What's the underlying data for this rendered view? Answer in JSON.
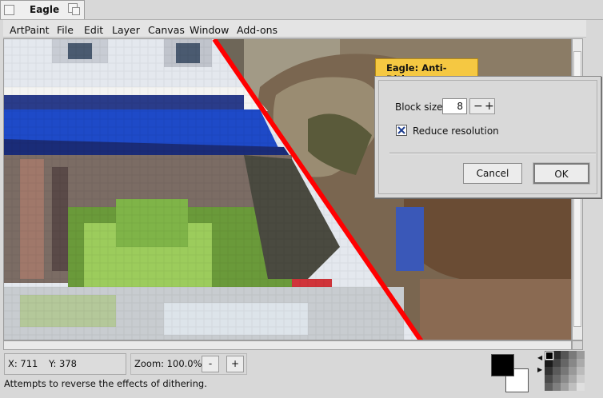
{
  "window": {
    "title": "Eagle"
  },
  "menu": [
    "ArtPaint",
    "File",
    "Edit",
    "Layer",
    "Canvas",
    "Window",
    "Add-ons"
  ],
  "status": {
    "x_label": "X: 711",
    "y_label": "Y: 378",
    "zoom_label": "Zoom: 100.0%",
    "zoom_out": "-",
    "zoom_in": "+",
    "message": "Attempts to reverse the effects of dithering."
  },
  "colors": {
    "foreground": "#000000",
    "background": "#ffffff",
    "accent": "#f5c842",
    "divider_line": "#ff0000"
  },
  "dialog": {
    "title": "Eagle: Anti-Dither",
    "block_size_label": "Block size:",
    "block_size_value": "8",
    "stepper_minus": "−",
    "stepper_plus": "+",
    "reduce_resolution_label": "Reduce resolution",
    "reduce_resolution_checked": true,
    "cancel_label": "Cancel",
    "ok_label": "OK"
  }
}
